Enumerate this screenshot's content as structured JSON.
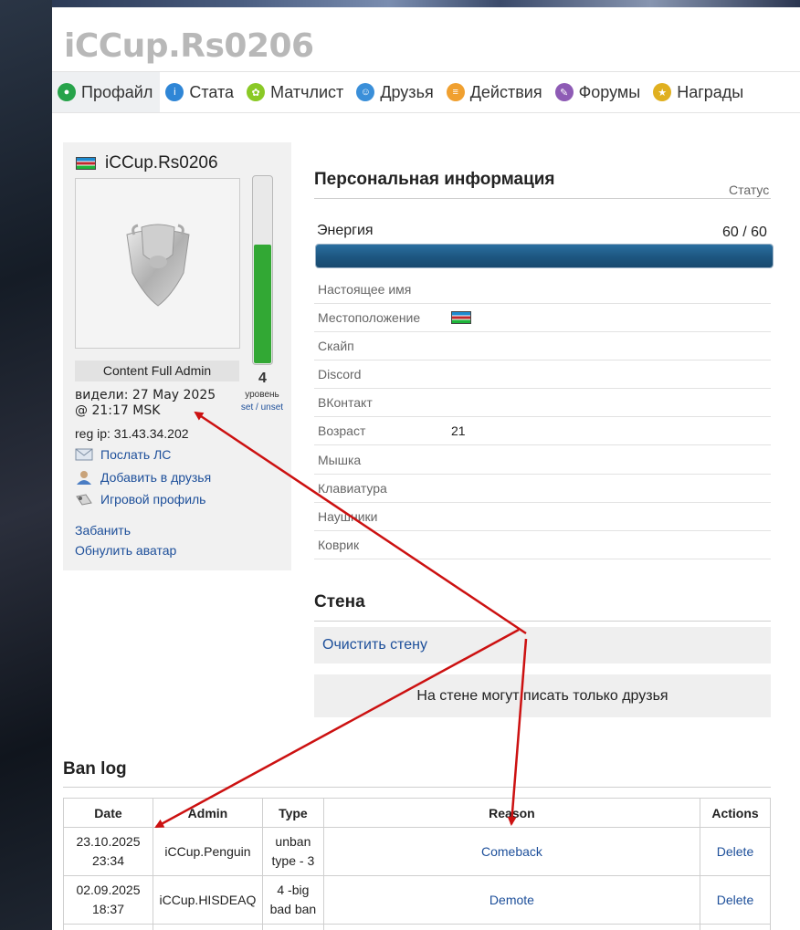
{
  "page_title": "iCCup.Rs0206",
  "nav": [
    {
      "label": "Профайл",
      "icon": "profile-icon",
      "color": "#27a34a",
      "active": true
    },
    {
      "label": "Стата",
      "icon": "stats-icon",
      "color": "#2f86d6",
      "active": false
    },
    {
      "label": "Матчлист",
      "icon": "matchlist-icon",
      "color": "#8ac926",
      "active": false
    },
    {
      "label": "Друзья",
      "icon": "friends-icon",
      "color": "#3a8fd9",
      "active": false
    },
    {
      "label": "Действия",
      "icon": "actions-icon",
      "color": "#f0a030",
      "active": false
    },
    {
      "label": "Форумы",
      "icon": "forums-icon",
      "color": "#8e5bb5",
      "active": false
    },
    {
      "label": "Награды",
      "icon": "awards-icon",
      "color": "#e0b020",
      "active": false
    }
  ],
  "profile": {
    "username": "iCCup.Rs0206",
    "role": "Content Full Admin",
    "last_seen": "видели: 27 May 2025 @ 21:17 MSK",
    "reg_ip": "reg ip: 31.43.34.202",
    "level": "4",
    "level_label": "уровень",
    "level_links": "set / unset",
    "level_fill": 0.63,
    "actions": {
      "send_pm": "Послать ЛС",
      "add_friend": "Добавить в друзья",
      "game_profile": "Игровой профиль",
      "ban": "Забанить",
      "reset_avatar": "Обнулить аватар"
    }
  },
  "personal": {
    "title": "Персональная информация",
    "status_label": "Статус",
    "energy_label": "Энергия",
    "energy_value": "60 / 60",
    "energy_fraction": 1.0,
    "fields": [
      {
        "label": "Настоящее имя",
        "value": ""
      },
      {
        "label": "Местоположение",
        "value": "",
        "flag": true
      },
      {
        "label": "Скайп",
        "value": ""
      },
      {
        "label": "Discord",
        "value": ""
      },
      {
        "label": "ВКонтакт",
        "value": ""
      },
      {
        "label": "Возраст",
        "value": "21"
      },
      {
        "label": "Мышка",
        "value": ""
      },
      {
        "label": "Клавиатура",
        "value": ""
      },
      {
        "label": "Наушники",
        "value": ""
      },
      {
        "label": "Коврик",
        "value": ""
      }
    ]
  },
  "wall": {
    "title": "Стена",
    "clear": "Очистить стену",
    "note": "На стене могут писать только друзья"
  },
  "banlog": {
    "title": "Ban log",
    "headers": {
      "date": "Date",
      "admin": "Admin",
      "type": "Type",
      "reason": "Reason",
      "actions": "Actions"
    },
    "rows": [
      {
        "date": "23.10.2025 23:34",
        "admin": "iCCup.Penguin",
        "type": "unban type - 3",
        "reason": "Comeback",
        "action": "Delete"
      },
      {
        "date": "02.09.2025 18:37",
        "admin": "iCCup.HISDEAQ",
        "type": "4 -big bad ban",
        "reason": "Demote",
        "action": "Delete"
      }
    ]
  },
  "colors": {
    "accent": "#1d4f9a",
    "arrow": "#cc1111",
    "level_green": "#32a834",
    "energy": "#1d5680"
  }
}
